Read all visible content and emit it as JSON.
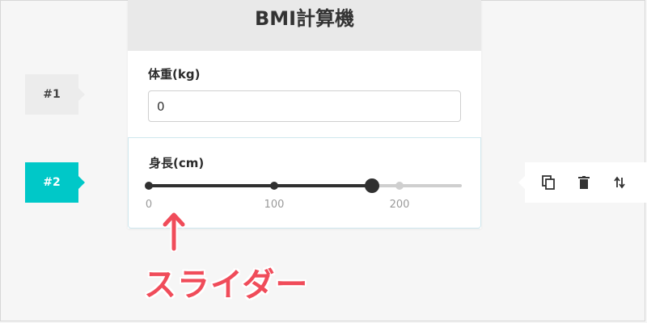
{
  "steps": [
    {
      "label": "#1",
      "active": false
    },
    {
      "label": "#2",
      "active": true
    }
  ],
  "card": {
    "title": "BMI計算機",
    "weight": {
      "label": "体重(kg)",
      "value": "0"
    },
    "height": {
      "label": "身長(cm)",
      "slider": {
        "min": 0,
        "max": 250,
        "value": 178,
        "ticks": [
          0,
          100,
          200
        ],
        "tick_labels": [
          "0",
          "100",
          "200"
        ]
      }
    }
  },
  "toolbar": {
    "icons": [
      "copy-icon",
      "trash-icon",
      "swap-vertical-icon"
    ]
  },
  "annotation": {
    "arrow": "↑",
    "text": "スライダー",
    "color": "#f04c5a"
  },
  "colors": {
    "accent": "#00c8c8",
    "slider_active": "#303030",
    "slider_inactive": "#cfcfcf"
  }
}
